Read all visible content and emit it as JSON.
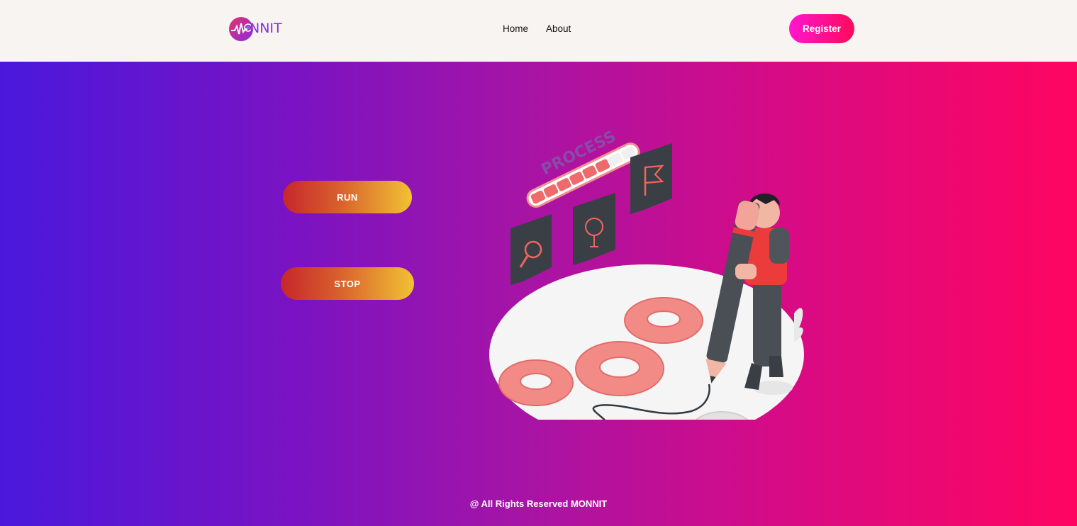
{
  "header": {
    "logo_text": "NNIT",
    "nav": {
      "home": "Home",
      "about": "About"
    },
    "register_label": "Register"
  },
  "main": {
    "run_label": "RUN",
    "stop_label": "STOP",
    "illustration_text": "PROCESS",
    "progress_fraction": 0.75
  },
  "footer": {
    "text": "@ All Rights Reserved MONNIT"
  },
  "colors": {
    "gradient_start": "#4a18dc",
    "gradient_end": "#ff0560",
    "register_start": "#ff16d0",
    "register_end": "#ff0a5a",
    "action_start": "#c6262b",
    "action_end": "#f2c233"
  }
}
